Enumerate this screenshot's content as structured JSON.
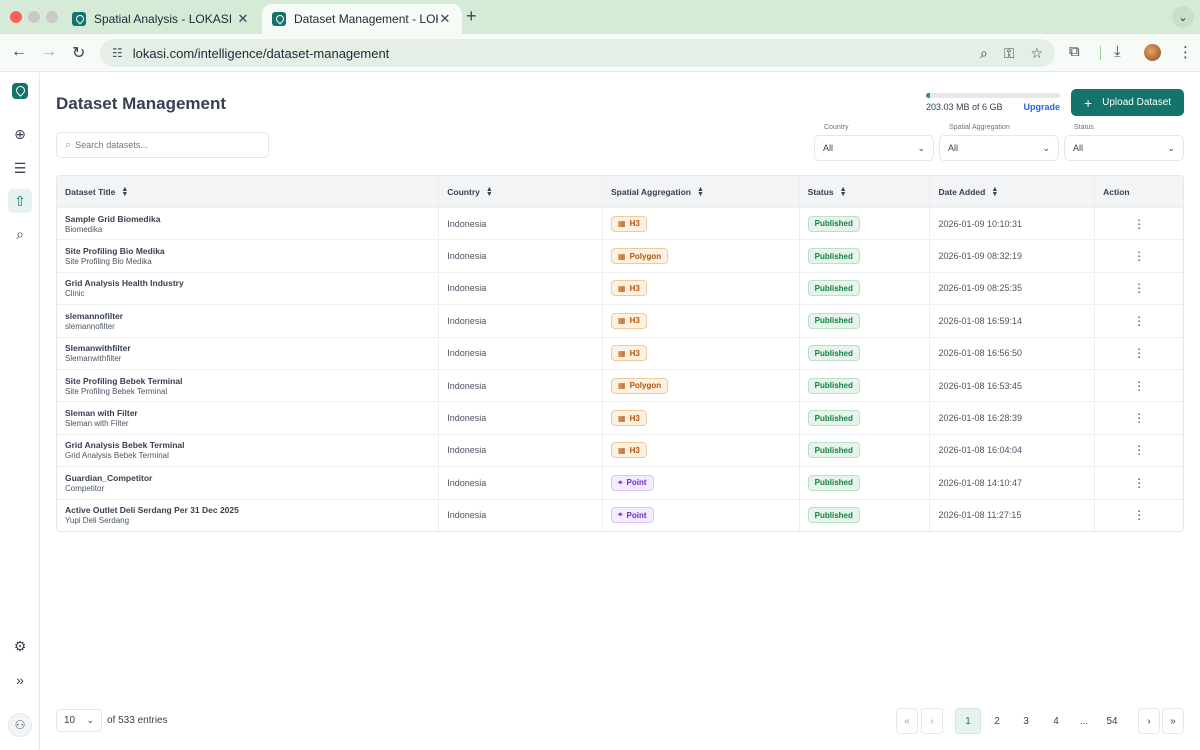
{
  "browser": {
    "tabs": [
      {
        "title": "Spatial Analysis - LOKASI",
        "close": "✕"
      },
      {
        "title": "Dataset Management - LOKASI",
        "close": "✕"
      }
    ],
    "new_tab": "+",
    "tab_menu": "⌄",
    "url": "lokasi.com/intelligence/dataset-management"
  },
  "header": {
    "title": "Dataset Management",
    "storage": {
      "used_text": "203.03 MB of 6 GB",
      "used_fraction": 0.033,
      "upgrade_label": "Upgrade"
    },
    "upload_label": "Upload Dataset",
    "upload_icon": "+"
  },
  "search": {
    "placeholder": "Search datasets..."
  },
  "filters": [
    {
      "label": "Country",
      "value": "All"
    },
    {
      "label": "Spatial Aggregation",
      "value": "All"
    },
    {
      "label": "Status",
      "value": "All"
    }
  ],
  "table": {
    "columns": [
      "Dataset Title",
      "Country",
      "Spatial Aggregation",
      "Status",
      "Date Added",
      "Action"
    ],
    "rows": [
      {
        "title": "Sample Grid Biomedika",
        "subtitle": "Biomedika",
        "country": "Indonesia",
        "aggregation": "H3",
        "status": "Published",
        "date": "2026-01-09 10:10:31"
      },
      {
        "title": "Site Profiling Bio Medika",
        "subtitle": "Site Profiling Bio Medika",
        "country": "Indonesia",
        "aggregation": "Polygon",
        "status": "Published",
        "date": "2026-01-09 08:32:19"
      },
      {
        "title": "Grid Analysis Health Industry",
        "subtitle": "Clinic",
        "country": "Indonesia",
        "aggregation": "H3",
        "status": "Published",
        "date": "2026-01-09 08:25:35"
      },
      {
        "title": "slemannofilter",
        "subtitle": "slemannofilter",
        "country": "Indonesia",
        "aggregation": "H3",
        "status": "Published",
        "date": "2026-01-08 16:59:14"
      },
      {
        "title": "Slemanwithfilter",
        "subtitle": "Slemanwithfilter",
        "country": "Indonesia",
        "aggregation": "H3",
        "status": "Published",
        "date": "2026-01-08 16:56:50"
      },
      {
        "title": "Site Profiling Bebek Terminal",
        "subtitle": "Site Profiling Bebek Terminal",
        "country": "Indonesia",
        "aggregation": "Polygon",
        "status": "Published",
        "date": "2026-01-08 16:53:45"
      },
      {
        "title": "Sleman with Filter",
        "subtitle": "Sleman with Filter",
        "country": "Indonesia",
        "aggregation": "H3",
        "status": "Published",
        "date": "2026-01-08 16:28:39"
      },
      {
        "title": "Grid Analysis Bebek Terminal",
        "subtitle": "Grid Analysis Bebek Terminal",
        "country": "Indonesia",
        "aggregation": "H3",
        "status": "Published",
        "date": "2026-01-08 16:04:04"
      },
      {
        "title": "Guardian_Competitor",
        "subtitle": "Competitor",
        "country": "Indonesia",
        "aggregation": "Point",
        "status": "Published",
        "date": "2026-01-08 14:10:47"
      },
      {
        "title": "Active Outlet Deli Serdang Per 31 Dec 2025",
        "subtitle": "Yupi Deli Serdang",
        "country": "Indonesia",
        "aggregation": "Point",
        "status": "Published",
        "date": "2026-01-08 11:27:15"
      }
    ]
  },
  "footer": {
    "per_page": "10",
    "entries_text": "of 533 entries",
    "pages": [
      "1",
      "2",
      "3",
      "4",
      "...",
      "54"
    ],
    "current_page": "1"
  },
  "icons": {
    "agg_h3": "grid-icon",
    "agg_polygon": "grid-icon",
    "agg_point": "location-pin-icon",
    "action": "kebab-menu-icon"
  },
  "colors": {
    "brand": "#14736b",
    "link": "#2563eb",
    "published": "#15803d",
    "h3_polygon": "#b45309",
    "point": "#6d28d9"
  }
}
